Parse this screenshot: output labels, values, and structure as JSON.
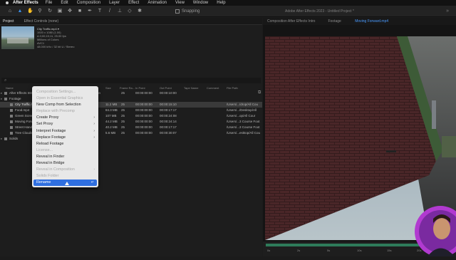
{
  "menubar": {
    "app_name": "After Effects",
    "items": [
      "File",
      "Edit",
      "Composition",
      "Layer",
      "Effect",
      "Animation",
      "View",
      "Window",
      "Help"
    ]
  },
  "toolbar": {
    "snapping_label": "Snapping",
    "document_title": "Adobe After Effects 2023 - Untitled Project *"
  },
  "project_panel": {
    "tabs": [
      "Project",
      "Effect Controls (none)"
    ],
    "preview_info": {
      "name": "City Traffic.mp4 ▾",
      "lines": [
        "1920 x 1080 (1.00)",
        "Δ 0;00;15;11, 25.00 fps",
        "Millions of Colors",
        "AVC1",
        "48.000 kHz / 32 bit U / Stereo"
      ]
    },
    "search_placeholder": "⌕",
    "columns": [
      "Name",
      "Type",
      "Size",
      "Frame Ra...",
      "In Point",
      "Out Point",
      "Tape Name",
      "Comment",
      "File Path"
    ],
    "rows": [
      {
        "name": "After Effects Intro",
        "type": "Composition",
        "size": "",
        "fps": "25",
        "in": "00:00:00:00",
        "out": "00:00:10:00",
        "path": "",
        "indent": 0,
        "selected": false
      },
      {
        "name": "Footage",
        "type": "Folder",
        "size": "",
        "fps": "",
        "in": "",
        "out": "",
        "path": "",
        "indent": 0,
        "selected": false
      },
      {
        "name": "City Traffic.mp4",
        "type": "MPEG",
        "size": "11.2 MB",
        "fps": "25",
        "in": "00:00:00:00",
        "out": "00:00:15:10",
        "path": "/Users/.../drop/All Cou",
        "indent": 1,
        "selected": true
      },
      {
        "name": "Food.mp4",
        "type": "MPEG",
        "size": "84.3 MB",
        "fps": "25",
        "in": "00:00:00:00",
        "out": "00:00:17:17",
        "path": "/Users/.../Desktop/All",
        "indent": 1,
        "selected": false
      },
      {
        "name": "Green Screen.mp4",
        "type": "MPEG",
        "size": "107 MB",
        "fps": "25",
        "in": "00:00:00:00",
        "out": "00:00:24:08",
        "path": "/Users/...op/All Cour",
        "indent": 1,
        "selected": false
      },
      {
        "name": "Moving Forward.mp4",
        "type": "MPEG",
        "size": "44.2 MB",
        "fps": "25",
        "in": "00:00:00:00",
        "out": "00:00:24:14",
        "path": "/Users/...3 Course Foot",
        "indent": 1,
        "selected": false
      },
      {
        "name": "Street Hands.mp4",
        "type": "MPEG",
        "size": "40.2 MB",
        "fps": "25",
        "in": "00:00:00:00",
        "out": "00:00:17:17",
        "path": "/Users/...3 Course Foot",
        "indent": 1,
        "selected": false
      },
      {
        "name": "Tree Clouds.mp4",
        "type": "MPEG",
        "size": "5.6 MB",
        "fps": "25",
        "in": "00:00:00:00",
        "out": "00:00:30:07",
        "path": "/Users/...esktop/All Cou",
        "indent": 1,
        "selected": false
      },
      {
        "name": "Solids",
        "type": "Folder",
        "size": "",
        "fps": "",
        "in": "",
        "out": "",
        "path": "",
        "indent": 0,
        "selected": false
      }
    ]
  },
  "context_menu": {
    "items": [
      {
        "label": "Composition Settings...",
        "disabled": true,
        "submenu": false
      },
      {
        "label": "Open in Essential Graphics",
        "disabled": true,
        "submenu": false
      },
      {
        "label": "New Comp from Selection",
        "disabled": false,
        "submenu": false
      },
      {
        "label": "Replace with Precomp",
        "disabled": true,
        "submenu": false
      },
      {
        "label": "Create Proxy",
        "disabled": false,
        "submenu": true
      },
      {
        "label": "Set Proxy",
        "disabled": false,
        "submenu": true
      },
      {
        "label": "Interpret Footage",
        "disabled": false,
        "submenu": true
      },
      {
        "label": "Replace Footage",
        "disabled": false,
        "submenu": true
      },
      {
        "label": "Reload Footage",
        "disabled": false,
        "submenu": false
      },
      {
        "label": "License...",
        "disabled": true,
        "submenu": false
      },
      {
        "label": "Reveal in Finder",
        "disabled": false,
        "submenu": false
      },
      {
        "label": "Reveal in Bridge",
        "disabled": false,
        "submenu": false
      },
      {
        "label": "Reveal in Composition",
        "disabled": true,
        "submenu": true
      },
      {
        "label": "Solids Folder",
        "disabled": true,
        "submenu": false
      }
    ],
    "highlighted": {
      "label": "Rename",
      "shortcut": "↵"
    }
  },
  "viewer": {
    "tabs": [
      "Composition After Effects Intro",
      "Footage"
    ],
    "active_file": "Moving Forward.mp4",
    "timecodes": [
      "0s",
      "2s",
      "5s",
      "10s",
      "15s",
      "20s"
    ]
  }
}
